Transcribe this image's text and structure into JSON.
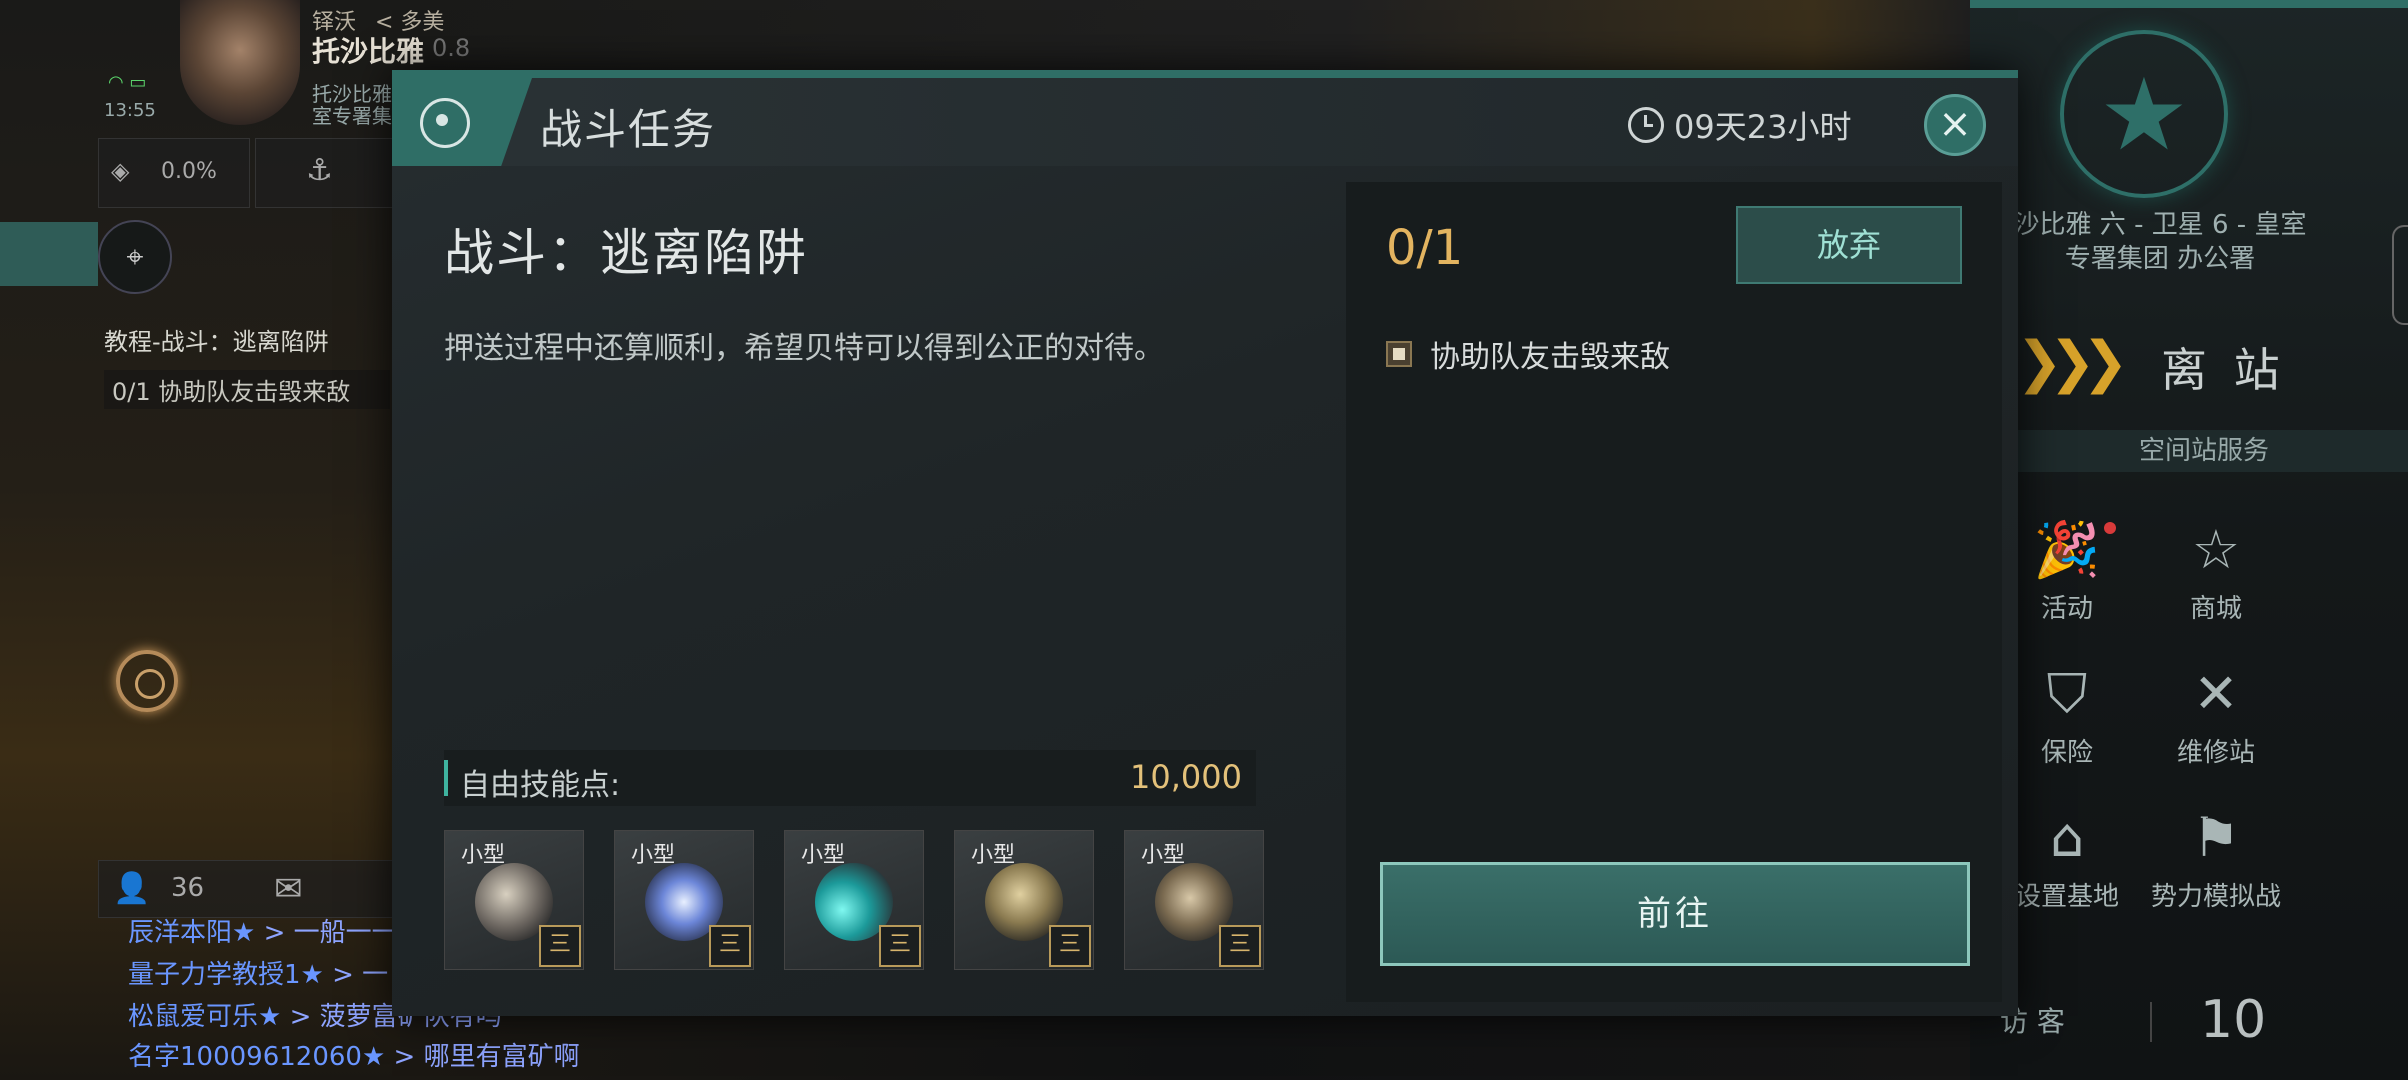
{
  "hud": {
    "player_rank": "铎沃",
    "player_sub": "< 多美",
    "player_name": "托沙比雅",
    "player_score": "0.8",
    "player_org": "托沙比雅",
    "player_org2": "室专署集",
    "time": "13:55",
    "percent": "0.0%",
    "quest_title": "教程-战斗：逃离陷阱",
    "quest_progress": "0/1 协助队友击毁来敌"
  },
  "chat": {
    "count": "36",
    "lines": [
      {
        "name": "辰洋本阳★",
        "msg": "> 一船一一"
      },
      {
        "name": "量子力学教授1★",
        "msg": "> 一"
      },
      {
        "name": "松鼠爱可乐★",
        "msg": "> 菠萝富矿队有吗"
      },
      {
        "name": "名字10009612060★",
        "msg": "> 哪里有富矿啊"
      }
    ]
  },
  "right_panel": {
    "location": "沙比雅 六 - 卫星 6 - 皇室专署集团 办公署",
    "depart_label": "离 站",
    "services_title": "空间站服务",
    "services": [
      {
        "label": "活动",
        "icon": "party-popper-icon"
      },
      {
        "label": "商城",
        "icon": "mall-star-icon"
      },
      {
        "label": "保险",
        "icon": "shield-icon"
      },
      {
        "label": "维修站",
        "icon": "wrench-screwdriver-icon"
      },
      {
        "label": "设置基地",
        "icon": "base-icon"
      },
      {
        "label": "势力模拟战",
        "icon": "crossed-flags-icon"
      }
    ],
    "visitor_label": "访 客",
    "visitor_count": "10"
  },
  "modal": {
    "title": "战斗任务",
    "timer": "09天23小时",
    "close_icon": "×",
    "mission_name": "战斗：逃离陷阱",
    "description": "押送过程中还算顺利，希望贝特可以得到公正的对待。",
    "reward_label": "自由技能点:",
    "reward_value": "10,000",
    "items": [
      {
        "tag": "小型",
        "icon": "scope-module-icon",
        "menu": "三"
      },
      {
        "tag": "小型",
        "icon": "electric-module-icon",
        "menu": "三"
      },
      {
        "tag": "小型",
        "icon": "thruster-module-icon",
        "menu": "三"
      },
      {
        "tag": "小型",
        "icon": "helmet-module-icon",
        "menu": "三"
      },
      {
        "tag": "小型",
        "icon": "armor-module-icon",
        "menu": "三"
      }
    ],
    "progress": "0/1",
    "abandon_label": "放弃",
    "objective": "协助队友击毁来敌",
    "go_label": "前往"
  },
  "colors": {
    "accent_teal": "#2f6e66",
    "gold": "#e3b460",
    "chat_blue": "#6a96ff"
  }
}
